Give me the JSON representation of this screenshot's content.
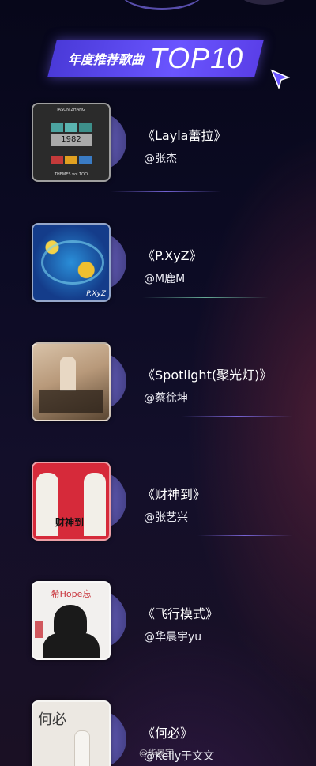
{
  "banner": {
    "title_cn": "年度推荐歌曲",
    "title_en": "TOP10"
  },
  "songs": [
    {
      "title": "《Layla蕾拉》",
      "artist": "@张杰",
      "cover_label_top": "JASON ZHANG",
      "cover_number": "1982",
      "cover_label_bottom": "THEMES vol.TOO"
    },
    {
      "title": "《P.XyZ》",
      "artist": "@M鹿M",
      "cover_label": "P.XyZ"
    },
    {
      "title": "《Spotlight(聚光灯)》",
      "artist": "@蔡徐坤"
    },
    {
      "title": "《财神到》",
      "artist": "@张艺兴",
      "cover_label": "财神到"
    },
    {
      "title": "《飞行模式》",
      "artist": "@华晨宇yu",
      "cover_label": "希Hope忘"
    },
    {
      "title": "《何必》",
      "artist": "@Kelly于文文",
      "cover_label": "何必"
    }
  ],
  "watermark": "@华晨宇",
  "colors": {
    "banner": "#5a46f0",
    "disc": "#5e58b0",
    "background": "#0c0b24"
  }
}
